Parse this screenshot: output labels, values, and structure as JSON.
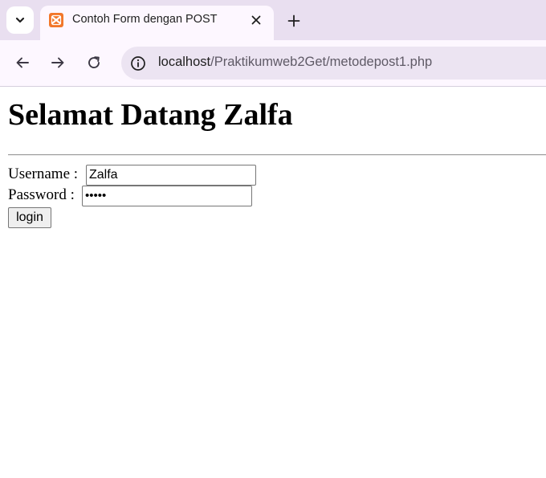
{
  "browser": {
    "tab_title": "Contoh Form dengan POST",
    "url_host": "localhost",
    "url_path": "/Praktikumweb2Get/metodepost1.php",
    "icons": {
      "tab_menu": "chevron-down-icon",
      "favicon": "xampp-icon",
      "close": "close-icon",
      "new_tab": "plus-icon",
      "back": "arrow-left-icon",
      "forward": "arrow-right-icon",
      "reload": "reload-icon",
      "site_info": "info-icon"
    },
    "colors": {
      "tabstrip": "#e9dff0",
      "toolbar": "#fdf7ff",
      "omnibox": "#ece4f2",
      "favicon": "#f2772a"
    }
  },
  "page": {
    "heading": "Selamat Datang Zalfa",
    "username_label": "Username :",
    "username_value": "Zalfa",
    "password_label": "Password :",
    "password_value": "•••••",
    "login_label": "login"
  }
}
